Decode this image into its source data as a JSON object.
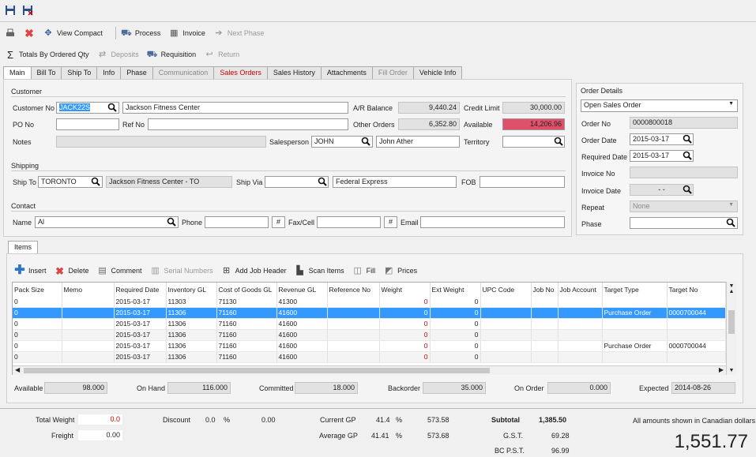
{
  "toolbar1": {
    "save_icon": "save-icon",
    "save_close_icon": "save-close-icon"
  },
  "toolbar2": {
    "print": "print-icon",
    "delete": "delete-icon",
    "view_compact": "View Compact",
    "process": "Process",
    "invoice": "Invoice",
    "next_phase": "Next Phase"
  },
  "toolbar3": {
    "totals": "Totals By Ordered Qty",
    "deposits": "Deposits",
    "requisition": "Requisition",
    "return": "Return"
  },
  "tabs": [
    "Main",
    "Bill To",
    "Ship To",
    "Info",
    "Phase",
    "Communication",
    "Sales Orders",
    "Sales History",
    "Attachments",
    "Fill Order",
    "Vehicle Info"
  ],
  "customer": {
    "section": "Customer",
    "customer_no_label": "Customer No",
    "customer_no": "JACK22S",
    "customer_name": "Jackson Fitness Center",
    "ar_label": "A/R Balance",
    "ar": "9,440.24",
    "credit_label": "Credit Limit",
    "credit": "30,000.00",
    "po_label": "PO No",
    "ref_label": "Ref No",
    "other_label": "Other Orders",
    "other": "6,352.80",
    "available_label": "Available",
    "available": "14,206.96",
    "notes_label": "Notes",
    "salesperson_label": "Salesperson",
    "salesperson": "JOHN",
    "salesperson_name": "John Ather",
    "territory_label": "Territory"
  },
  "shipping": {
    "section": "Shipping",
    "ship_to_label": "Ship To",
    "ship_to": "TORONTO",
    "ship_to_name": "Jackson Fitness Center  - TO",
    "ship_via_label": "Ship Via",
    "ship_via_name": "Federal Express",
    "fob_label": "FOB"
  },
  "contact": {
    "section": "Contact",
    "name_label": "Name",
    "name": "Al",
    "phone_label": "Phone",
    "fax_label": "Fax/Cell",
    "email_label": "Email",
    "hash": "#"
  },
  "order": {
    "section": "Order Details",
    "type": "Open Sales Order",
    "order_no_label": "Order No",
    "order_no": "0000800018",
    "order_date_label": "Order Date",
    "order_date": "2015-03-17",
    "required_label": "Required Date",
    "required": "2015-03-17",
    "invoice_no_label": "Invoice No",
    "invoice_date_label": "Invoice Date",
    "invoice_date": "- -",
    "repeat_label": "Repeat",
    "repeat": "None",
    "phase_label": "Phase"
  },
  "items_tab": "Items",
  "items_toolbar": {
    "insert": "Insert",
    "delete": "Delete",
    "comment": "Comment",
    "serial": "Serial Numbers",
    "add_job": "Add Job Header",
    "scan": "Scan Items",
    "fill": "Fill",
    "prices": "Prices"
  },
  "grid": {
    "headers": [
      "Pack Size",
      "Memo",
      "Required Date",
      "Inventory GL",
      "Cost of Goods GL",
      "Revenue GL",
      "Reference No",
      "Weight",
      "Ext Weight",
      "UPC Code",
      "Job No",
      "Job Account",
      "Target Type",
      "Target No"
    ],
    "rows": [
      [
        "0",
        "",
        "2015-03-17",
        "11303",
        "71130",
        "41300",
        "",
        "0",
        "0",
        "",
        "",
        "",
        "",
        ""
      ],
      [
        "0",
        "",
        "2015-03-17",
        "11306",
        "71160",
        "41600",
        "",
        "0",
        "0",
        "",
        "",
        "",
        "Purchase Order",
        "0000700044"
      ],
      [
        "0",
        "",
        "2015-03-17",
        "11306",
        "71160",
        "41600",
        "",
        "0",
        "0",
        "",
        "",
        "",
        "",
        ""
      ],
      [
        "0",
        "",
        "2015-03-17",
        "11306",
        "71160",
        "41600",
        "",
        "0",
        "0",
        "",
        "",
        "",
        "",
        ""
      ],
      [
        "0",
        "",
        "2015-03-17",
        "11306",
        "71160",
        "41600",
        "",
        "0",
        "0",
        "",
        "",
        "",
        "Purchase Order",
        "0000700044"
      ],
      [
        "0",
        "",
        "2015-03-17",
        "11306",
        "71160",
        "41600",
        "",
        "0",
        "0",
        "",
        "",
        "",
        "",
        ""
      ]
    ]
  },
  "stock": {
    "available_label": "Available",
    "available": "98.000",
    "onhand_label": "On Hand",
    "onhand": "116.000",
    "committed_label": "Committed",
    "committed": "18.000",
    "backorder_label": "Backorder",
    "backorder": "35.000",
    "onorder_label": "On Order",
    "onorder": "0.000",
    "expected_label": "Expected",
    "expected": "2014-08-26"
  },
  "totals": {
    "total_weight_label": "Total Weight",
    "total_weight": "0.0",
    "freight_label": "Freight",
    "freight": "0.00",
    "discount_label": "Discount",
    "discount_pct": "0.0",
    "pct": "%",
    "discount_amt": "0.00",
    "current_gp_label": "Current GP",
    "current_gp_pct": "41.4",
    "current_gp": "573.58",
    "avg_gp_label": "Average GP",
    "avg_gp_pct": "41.41",
    "avg_gp": "573.68",
    "subtotal_label": "Subtotal",
    "subtotal": "1,385.50",
    "gst_label": "G.S.T.",
    "gst": "69.28",
    "pst_label": "BC P.S.T.",
    "pst": "96.99",
    "currency_note": "All amounts shown in Canadian dollars.",
    "grand_total": "1,551.77"
  }
}
